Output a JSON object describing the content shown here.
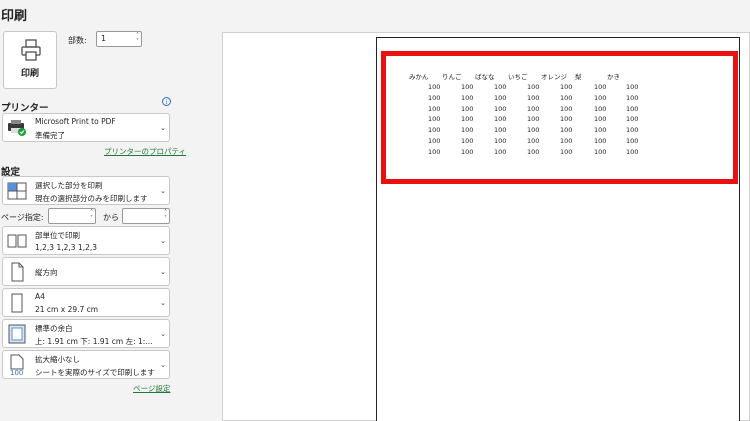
{
  "title": "印刷",
  "print_button": {
    "label": "印刷"
  },
  "copies": {
    "label": "部数:",
    "value": "1"
  },
  "printer": {
    "section_label": "プリンター",
    "name": "Microsoft Print to PDF",
    "status": "準備完了",
    "properties_link": "プリンターのプロパティ"
  },
  "settings": {
    "section_label": "設定",
    "scope": {
      "line1": "選択した部分を印刷",
      "line2": "現在の選択部分のみを印刷します"
    },
    "pages": {
      "label": "ページ指定:",
      "to": "から"
    },
    "collate": {
      "line1": "部単位で印刷",
      "line2": "1,2,3    1,2,3    1,2,3"
    },
    "orientation": {
      "line1": "縦方向"
    },
    "paper": {
      "line1": "A4",
      "line2": "21 cm x 29.7 cm"
    },
    "margins": {
      "line1": "標準の余白",
      "line2": "上: 1.91 cm 下: 1.91 cm 左: 1:..."
    },
    "scaling": {
      "line1": "拡大縮小なし",
      "line2": "シートを実際のサイズで印刷します"
    },
    "page_setup_link": "ページ設定"
  },
  "preview": {
    "headers": [
      "みかん",
      "りんご",
      "ばなな",
      "いちご",
      "オレンジ",
      "梨",
      "かき"
    ],
    "rows": [
      [
        "100",
        "100",
        "100",
        "100",
        "100",
        "100",
        "100"
      ],
      [
        "100",
        "100",
        "100",
        "100",
        "100",
        "100",
        "100"
      ],
      [
        "100",
        "100",
        "100",
        "100",
        "100",
        "100",
        "100"
      ],
      [
        "100",
        "100",
        "100",
        "100",
        "100",
        "100",
        "100"
      ],
      [
        "100",
        "100",
        "100",
        "100",
        "100",
        "100",
        "100"
      ],
      [
        "100",
        "100",
        "100",
        "100",
        "100",
        "100",
        "100"
      ],
      [
        "100",
        "100",
        "100",
        "100",
        "100",
        "100",
        "100"
      ]
    ],
    "highlight_color": "#e81010"
  }
}
